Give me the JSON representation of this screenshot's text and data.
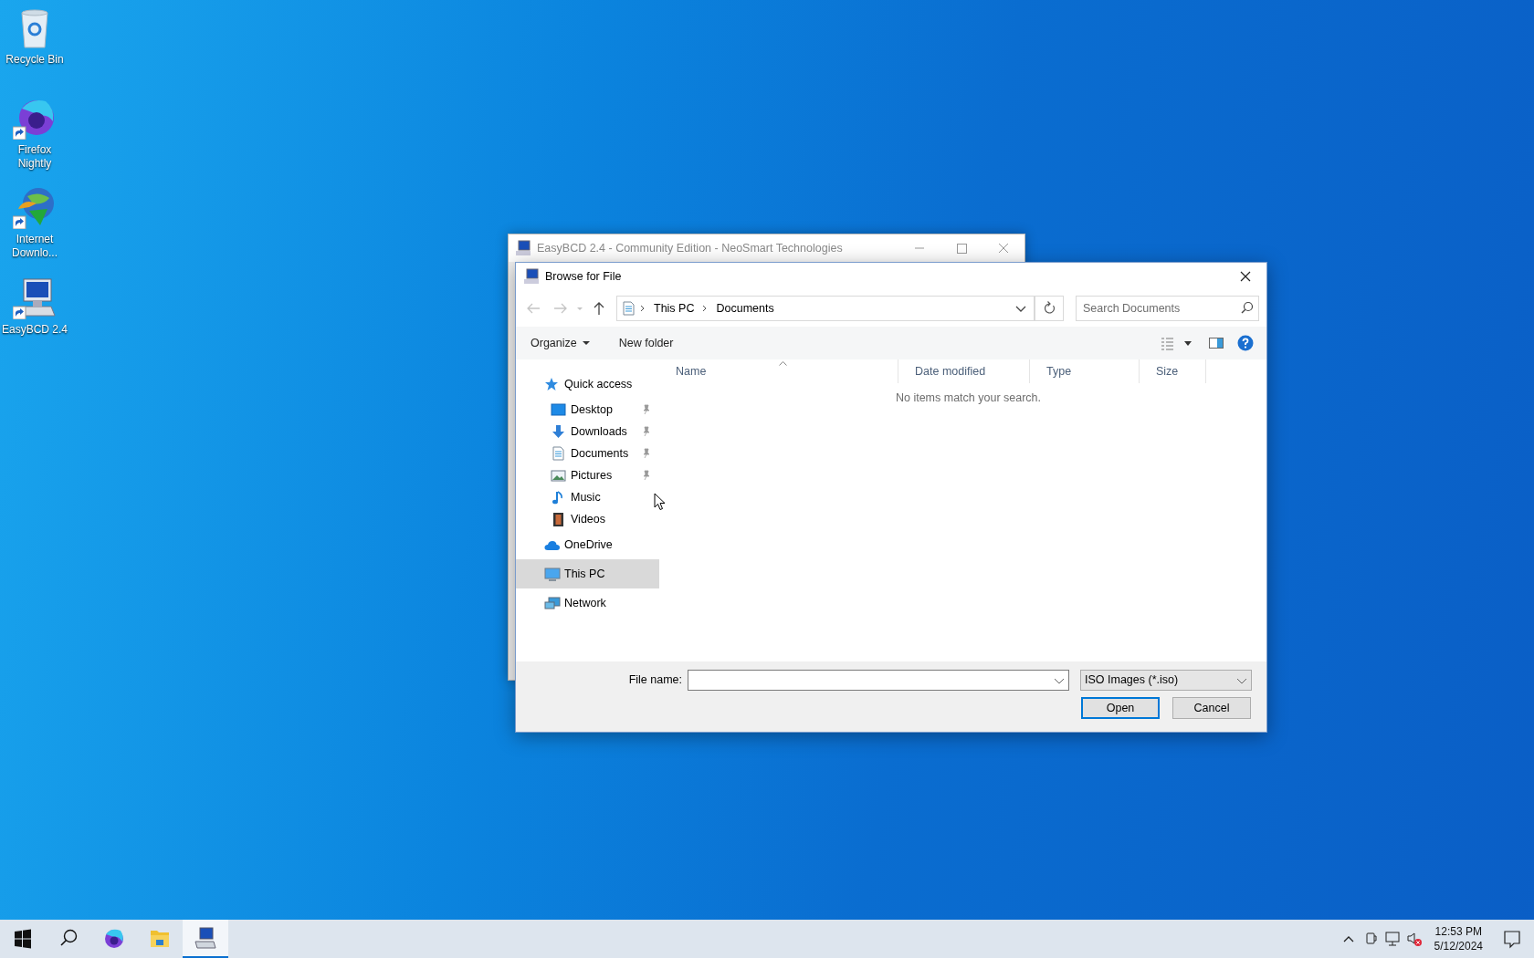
{
  "desktop_icons": [
    {
      "kind": "recycle-bin",
      "label": "Recycle Bin",
      "shortcut": false
    },
    {
      "kind": "firefox",
      "label": "Firefox Nightly",
      "shortcut": true
    },
    {
      "kind": "downloader",
      "label": "Internet Downlo...",
      "shortcut": true
    },
    {
      "kind": "easybcd",
      "label": "EasyBCD 2.4",
      "shortcut": true
    }
  ],
  "background_window": {
    "title": "EasyBCD 2.4 - Community Edition - NeoSmart Technologies"
  },
  "dialog": {
    "title": "Browse for File",
    "address": {
      "path": [
        "This PC",
        "Documents"
      ]
    },
    "search": {
      "placeholder": "Search Documents"
    },
    "toolbar": [
      {
        "label": "Organize",
        "dropdown": true
      },
      {
        "label": "New folder",
        "dropdown": false
      }
    ],
    "columns": [
      {
        "label": "Name",
        "sorted": true
      },
      {
        "label": "Date modified",
        "sorted": false
      },
      {
        "label": "Type",
        "sorted": false
      },
      {
        "label": "Size",
        "sorted": false
      }
    ],
    "empty_message": "No items match your search.",
    "nav": [
      {
        "kind": "star",
        "label": "Quick access",
        "selected": false,
        "children": [
          {
            "kind": "desktop",
            "label": "Desktop",
            "pinned": true,
            "selected": false
          },
          {
            "kind": "download",
            "label": "Downloads",
            "pinned": true,
            "selected": false
          },
          {
            "kind": "document",
            "label": "Documents",
            "pinned": true,
            "selected": false
          },
          {
            "kind": "picture",
            "label": "Pictures",
            "pinned": true,
            "selected": false
          },
          {
            "kind": "music",
            "label": "Music",
            "pinned": false,
            "selected": false
          },
          {
            "kind": "video",
            "label": "Videos",
            "pinned": false,
            "selected": false
          }
        ]
      },
      {
        "kind": "cloud",
        "label": "OneDrive",
        "selected": false
      },
      {
        "kind": "pc",
        "label": "This PC",
        "selected": true
      },
      {
        "kind": "network",
        "label": "Network",
        "selected": false
      }
    ],
    "file_name": {
      "label": "File name:"
    },
    "file_type": {
      "value": "ISO Images (*.iso)"
    },
    "buttons": [
      {
        "label": "Open",
        "default": true
      },
      {
        "label": "Cancel",
        "default": false
      }
    ]
  },
  "taskbar": {
    "items": [
      {
        "kind": "start",
        "selected": false
      },
      {
        "kind": "search",
        "selected": false
      },
      {
        "kind": "firefox",
        "selected": false
      },
      {
        "kind": "folder",
        "selected": false
      },
      {
        "kind": "easybcd",
        "selected": true
      }
    ],
    "clock": {
      "time": "12:53 PM",
      "date": "5/12/2024"
    }
  }
}
